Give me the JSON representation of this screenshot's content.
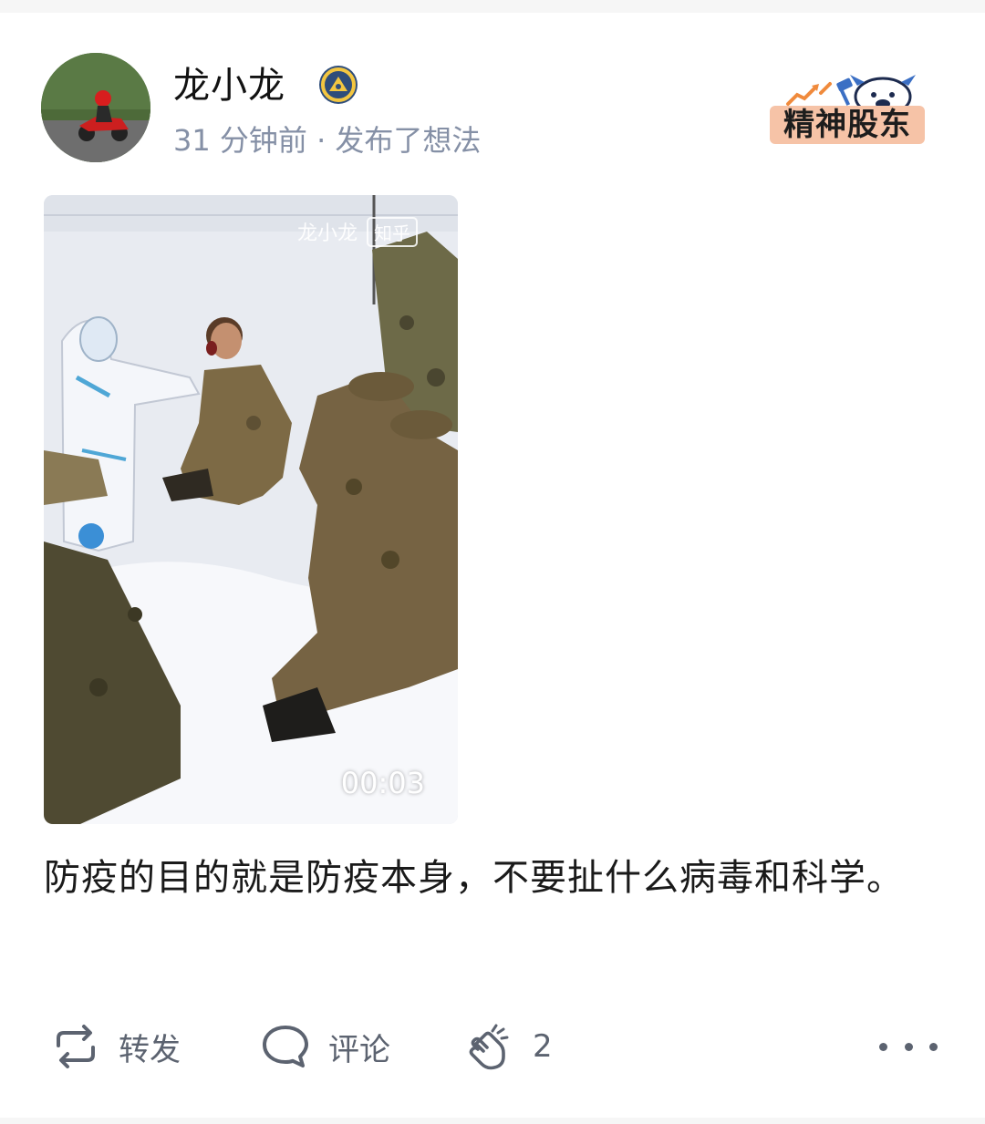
{
  "post": {
    "author": {
      "name": "龙小龙",
      "avatar_icon": "avatar-motorcycle-rider",
      "badge_icon": "verified-badge-icon"
    },
    "meta": "31 分钟前 · 发布了想法",
    "brand_badge": {
      "label": "精神股东",
      "icon": "cow-mascot-icon"
    },
    "video": {
      "watermark_author": "龙小龙",
      "watermark_site": "知乎",
      "duration": "00:03"
    },
    "text": "防疫的目的就是防疫本身，不要扯什么病毒和科学。"
  },
  "actions": {
    "repost_label": "转发",
    "comment_label": "评论",
    "clap_count": "2"
  },
  "colors": {
    "text_primary": "#121212",
    "text_secondary": "#8590a6",
    "action_gray": "#5c6370",
    "badge_bg": "#f6c3a7"
  }
}
